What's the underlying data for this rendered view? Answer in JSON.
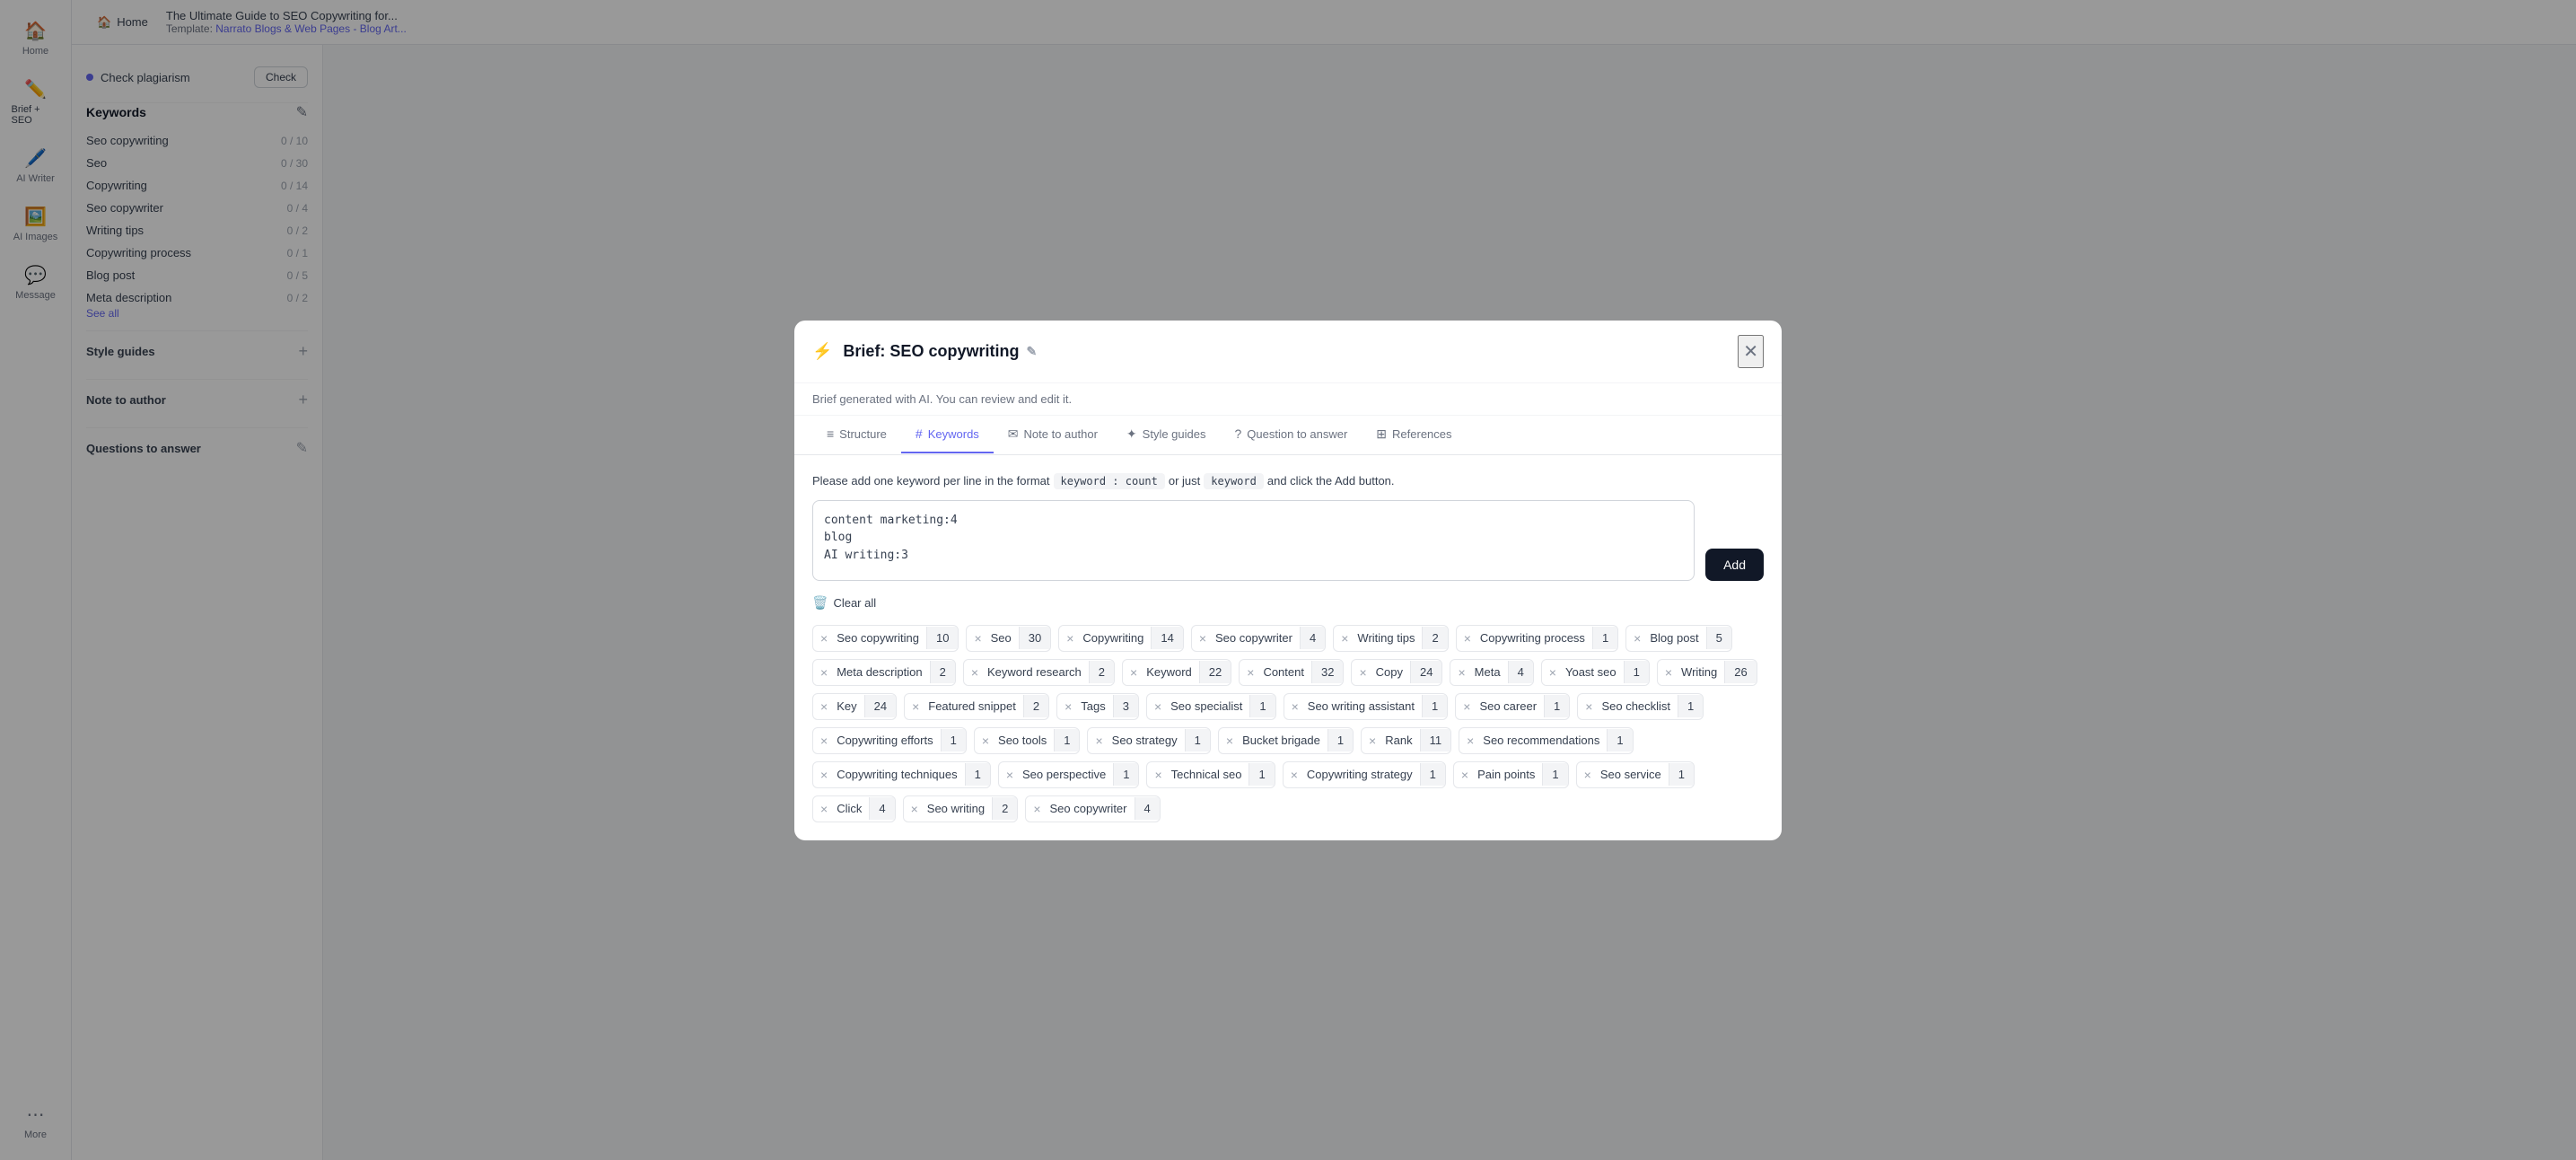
{
  "sidebar": {
    "items": [
      {
        "id": "home",
        "label": "Home",
        "icon": "🏠",
        "active": false
      },
      {
        "id": "brief-seo",
        "label": "Brief + SEO",
        "icon": "✏️",
        "active": true
      },
      {
        "id": "ai-writer",
        "label": "AI Writer",
        "icon": "🖊️",
        "active": false
      },
      {
        "id": "ai-images",
        "label": "AI Images",
        "icon": "🖼️",
        "active": false
      },
      {
        "id": "message",
        "label": "Message",
        "icon": "💬",
        "active": false
      },
      {
        "id": "more",
        "label": "More",
        "icon": "⋯",
        "active": false
      }
    ]
  },
  "topbar": {
    "home_label": "Home",
    "doc_title": "The Ultimate Guide to SEO Copywriting for...",
    "template_prefix": "Template:",
    "template_link": "Narrato Blogs & Web Pages - Blog Art..."
  },
  "left_panel": {
    "check_plagiarism_label": "Check plagiarism",
    "check_button_label": "Check",
    "keywords_title": "Keywords",
    "keywords": [
      {
        "name": "Seo copywriting",
        "count": "0 / 10"
      },
      {
        "name": "Seo",
        "count": "0 / 30"
      },
      {
        "name": "Copywriting",
        "count": "0 / 14"
      },
      {
        "name": "Seo copywriter",
        "count": "0 / 4"
      },
      {
        "name": "Writing tips",
        "count": "0 / 2"
      },
      {
        "name": "Copywriting process",
        "count": "0 / 1"
      },
      {
        "name": "Blog post",
        "count": "0 / 5"
      },
      {
        "name": "Meta description",
        "count": "0 / 2"
      }
    ],
    "see_all_label": "See all",
    "style_guides_title": "Style guides",
    "note_to_author_title": "Note to author",
    "questions_to_answer_title": "Questions to answer"
  },
  "modal": {
    "lightning_icon": "⚡",
    "title": "Brief: SEO copywriting",
    "edit_icon": "✏️",
    "close_icon": "✕",
    "subtitle": "Brief generated with AI. You can review and edit it.",
    "tabs": [
      {
        "id": "structure",
        "label": "Structure",
        "icon": "≡",
        "active": false
      },
      {
        "id": "keywords",
        "label": "Keywords",
        "icon": "#",
        "active": true
      },
      {
        "id": "note-to-author",
        "label": "Note to author",
        "icon": "✉",
        "active": false
      },
      {
        "id": "style-guides",
        "label": "Style guides",
        "icon": "✦",
        "active": false
      },
      {
        "id": "question-to-answer",
        "label": "Question to answer",
        "icon": "?",
        "active": false
      },
      {
        "id": "references",
        "label": "References",
        "icon": "⊞",
        "active": false
      }
    ],
    "keywords_section": {
      "format_hint": "Please add one keyword per line in the format",
      "code_badge_1": "keyword : count",
      "or_just": "or just",
      "code_badge_2": "keyword",
      "and_click": "and click the Add button.",
      "textarea_content": "content marketing:4\nblog\nAI writing:3",
      "add_button_label": "Add",
      "clear_all_label": "Clear all",
      "tags": [
        {
          "name": "Seo copywriting",
          "count": "10"
        },
        {
          "name": "Seo",
          "count": "30"
        },
        {
          "name": "Copywriting",
          "count": "14"
        },
        {
          "name": "Seo copywriter",
          "count": "4"
        },
        {
          "name": "Writing tips",
          "count": "2"
        },
        {
          "name": "Copywriting process",
          "count": "1"
        },
        {
          "name": "Blog post",
          "count": "5"
        },
        {
          "name": "Meta description",
          "count": "2"
        },
        {
          "name": "Keyword research",
          "count": "2"
        },
        {
          "name": "Keyword",
          "count": "22"
        },
        {
          "name": "Content",
          "count": "32"
        },
        {
          "name": "Copy",
          "count": "24"
        },
        {
          "name": "Meta",
          "count": "4"
        },
        {
          "name": "Yoast seo",
          "count": "1"
        },
        {
          "name": "Writing",
          "count": "26"
        },
        {
          "name": "Key",
          "count": "24"
        },
        {
          "name": "Featured snippet",
          "count": "2"
        },
        {
          "name": "Tags",
          "count": "3"
        },
        {
          "name": "Seo specialist",
          "count": "1"
        },
        {
          "name": "Seo writing assistant",
          "count": "1"
        },
        {
          "name": "Seo career",
          "count": "1"
        },
        {
          "name": "Seo checklist",
          "count": "1"
        },
        {
          "name": "Copywriting efforts",
          "count": "1"
        },
        {
          "name": "Seo tools",
          "count": "1"
        },
        {
          "name": "Seo strategy",
          "count": "1"
        },
        {
          "name": "Bucket brigade",
          "count": "1"
        },
        {
          "name": "Rank",
          "count": "11"
        },
        {
          "name": "Seo recommendations",
          "count": "1"
        },
        {
          "name": "Copywriting techniques",
          "count": "1"
        },
        {
          "name": "Seo perspective",
          "count": "1"
        },
        {
          "name": "Technical seo",
          "count": "1"
        },
        {
          "name": "Copywriting strategy",
          "count": "1"
        },
        {
          "name": "Pain points",
          "count": "1"
        },
        {
          "name": "Seo service",
          "count": "1"
        },
        {
          "name": "Click",
          "count": "4"
        },
        {
          "name": "Seo writing",
          "count": "2"
        },
        {
          "name": "Seo copywriter",
          "count": "4"
        }
      ]
    }
  }
}
